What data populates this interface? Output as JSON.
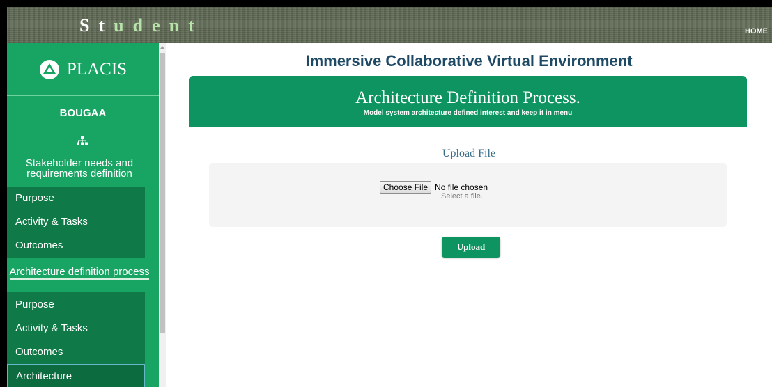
{
  "header": {
    "brand_letters": [
      "S",
      "t",
      "u",
      "d",
      "e",
      "n",
      "t"
    ],
    "home_link": "HOME"
  },
  "sidebar": {
    "logo_text": "PLACIS",
    "user_name": "BOUGAA",
    "sections": [
      {
        "title": "Stakeholder needs and requirements definition",
        "items": [
          "Purpose",
          "Activity & Tasks",
          "Outcomes"
        ]
      },
      {
        "title": "Architecture definition process",
        "items": [
          "Purpose",
          "Activity & Tasks",
          "Outcomes",
          "Architecture"
        ]
      }
    ],
    "active_item": "Architecture"
  },
  "main": {
    "page_title": "Immersive Collaborative Virtual Environment",
    "banner": {
      "title": "Architecture Definition Process.",
      "subtitle": "Model system architecture defined interest and keep it in menu"
    },
    "upload": {
      "heading": "Upload File",
      "choose_label": "Choose File",
      "file_status": "No file chosen",
      "hint": "Select a file...",
      "submit_label": "Upload"
    }
  },
  "colors": {
    "sidebar_bg": "#18a463",
    "submenu_bg": "#0f7a47",
    "banner_bg": "#0e9460",
    "title_color": "#1f4a66"
  }
}
